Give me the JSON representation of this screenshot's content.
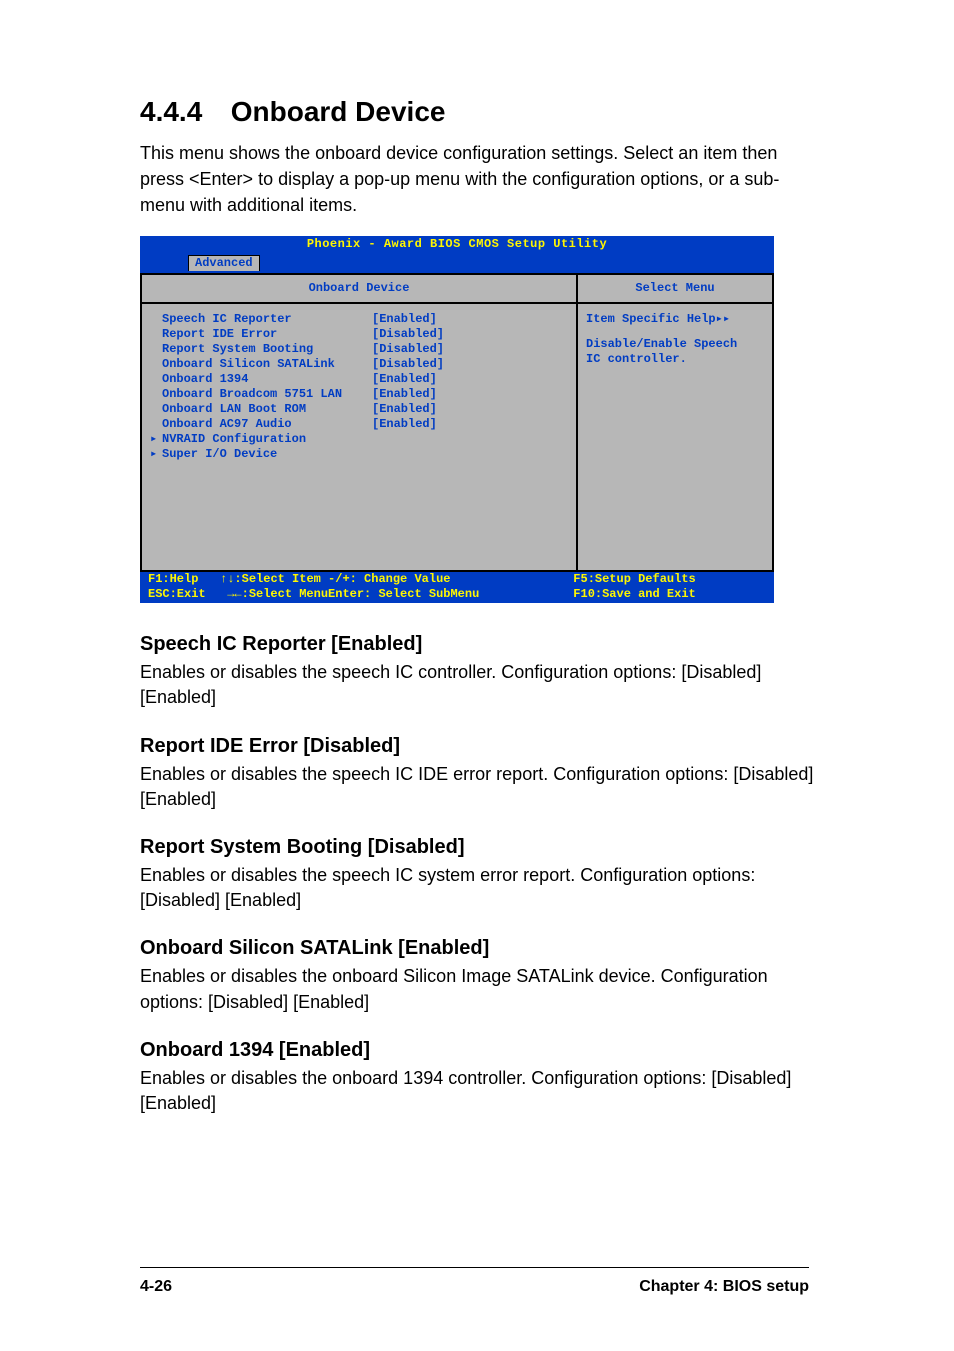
{
  "section": {
    "number": "4.4.4",
    "title": "Onboard Device"
  },
  "intro": "This menu shows the onboard device configuration settings. Select an item then press <Enter> to display a pop-up menu with the configuration options, or a sub-menu with additional items.",
  "bios": {
    "title": "Phoenix - Award BIOS CMOS Setup Utility",
    "tab": "Advanced",
    "left_panel_title": "Onboard Device",
    "right_panel_title": "Select Menu",
    "rows": [
      {
        "arrow": " ",
        "label": "Speech IC Reporter",
        "value": "[Enabled]"
      },
      {
        "arrow": " ",
        "label": "Report IDE Error",
        "value": "[Disabled]"
      },
      {
        "arrow": " ",
        "label": "Report System Booting",
        "value": "[Disabled]"
      },
      {
        "arrow": " ",
        "label": "Onboard Silicon SATALink",
        "value": "[Disabled]"
      },
      {
        "arrow": " ",
        "label": "Onboard 1394",
        "value": "[Enabled]"
      },
      {
        "arrow": " ",
        "label": "Onboard Broadcom 5751 LAN",
        "value": "[Enabled]"
      },
      {
        "arrow": " ",
        "label": "Onboard LAN Boot ROM",
        "value": "[Enabled]"
      },
      {
        "arrow": " ",
        "label": "Onboard AC97 Audio",
        "value": "[Enabled]"
      },
      {
        "arrow": "▸",
        "label": "NVRAID Configuration",
        "value": ""
      },
      {
        "arrow": "▸",
        "label": "Super I/O Device",
        "value": ""
      }
    ],
    "help_title": "Item Specific Help▸▸",
    "help_body1": "Disable/Enable Speech",
    "help_body2": "IC controller.",
    "footer": {
      "l1": "F1:Help",
      "l2": "ESC:Exit",
      "l3": "↑↓:Select Item",
      "l4": "→←:Select Menu",
      "m1": "-/+: Change Value",
      "m2": "Enter: Select SubMenu",
      "r1": "F5:Setup Defaults",
      "r2": "F10:Save and Exit"
    }
  },
  "items": [
    {
      "heading": "Speech IC Reporter [Enabled]",
      "body": "Enables or disables the speech IC controller. Configuration options: [Disabled] [Enabled]"
    },
    {
      "heading": "Report IDE Error [Disabled]",
      "body": "Enables or disables the speech IC IDE error report. Configuration options: [Disabled] [Enabled]"
    },
    {
      "heading": "Report System Booting [Disabled]",
      "body": "Enables or disables the speech IC system error report. Configuration options: [Disabled] [Enabled]"
    },
    {
      "heading": "Onboard Silicon SATALink [Enabled]",
      "body": "Enables or disables the onboard Silicon Image SATALink device. Configuration options: [Disabled] [Enabled]"
    },
    {
      "heading": "Onboard 1394 [Enabled]",
      "body": "Enables or disables the onboard 1394 controller. Configuration options: [Disabled] [Enabled]"
    }
  ],
  "footer": {
    "left": "4-26",
    "right": "Chapter 4: BIOS setup"
  }
}
